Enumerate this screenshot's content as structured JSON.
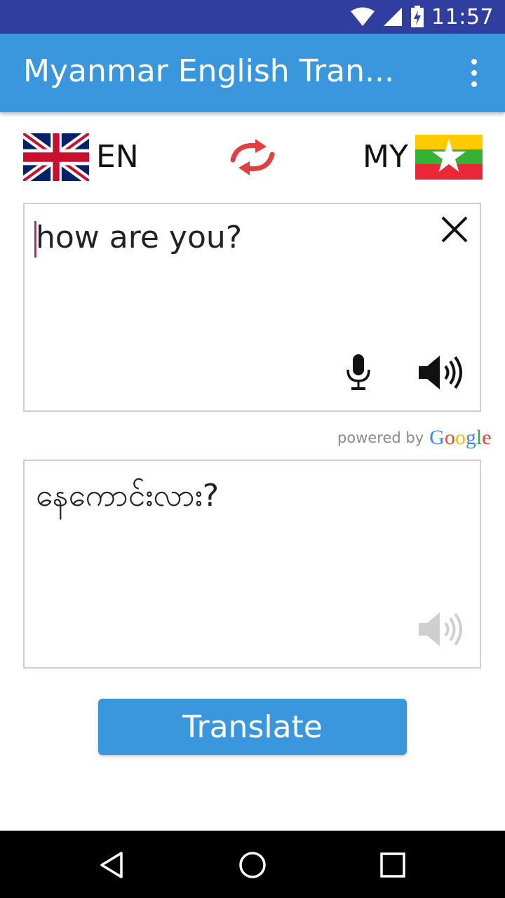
{
  "status_bar": {
    "time": "11:57"
  },
  "app_bar": {
    "title": "Myanmar English Tran..."
  },
  "languages": {
    "source_code": "EN",
    "target_code": "MY"
  },
  "input": {
    "text": "how are you?"
  },
  "output": {
    "text": "နေကောင်းလား?"
  },
  "powered_by": {
    "label": "powered by",
    "logo": [
      "G",
      "o",
      "o",
      "g",
      "l",
      "e"
    ],
    "logo_colors": [
      "#4285f4",
      "#ea4335",
      "#fbbc05",
      "#4285f4",
      "#34a853",
      "#ea4335"
    ]
  },
  "translate_button": {
    "label": "Translate"
  },
  "colors": {
    "status_bar": "#303f9f",
    "app_bar": "#3b97dd",
    "caret": "#d81b60",
    "button": "#3b97dd",
    "swap_arrows": "#e04040"
  },
  "icons": [
    "wifi-icon",
    "signal-icon",
    "battery-charging-icon",
    "more-vert-icon",
    "uk-flag-icon",
    "swap-icon",
    "myanmar-flag-icon",
    "close-icon",
    "mic-icon",
    "speaker-icon",
    "back-icon",
    "home-icon",
    "recents-icon"
  ]
}
